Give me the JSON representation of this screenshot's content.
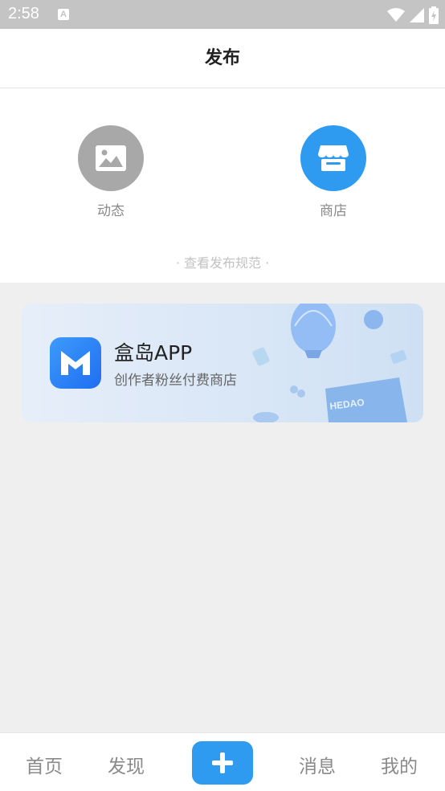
{
  "status_bar": {
    "time": "2:58",
    "notification_letter": "A"
  },
  "header": {
    "title": "发布"
  },
  "publish_options": [
    {
      "label": "动态",
      "icon": "image-icon",
      "color": "#a8a8a8"
    },
    {
      "label": "商店",
      "icon": "store-icon",
      "color": "#2e9bf0"
    }
  ],
  "rules_link": "· 查看发布规范 ·",
  "banner": {
    "title": "盒岛APP",
    "subtitle": "创作者粉丝付费商店",
    "box_text": "HEDAO"
  },
  "bottom_nav": {
    "home": "首页",
    "discover": "发现",
    "add_icon": "plus-icon",
    "messages": "消息",
    "mine": "我的"
  },
  "colors": {
    "accent": "#2e9bf0",
    "status_bar": "#c4c4c4"
  }
}
